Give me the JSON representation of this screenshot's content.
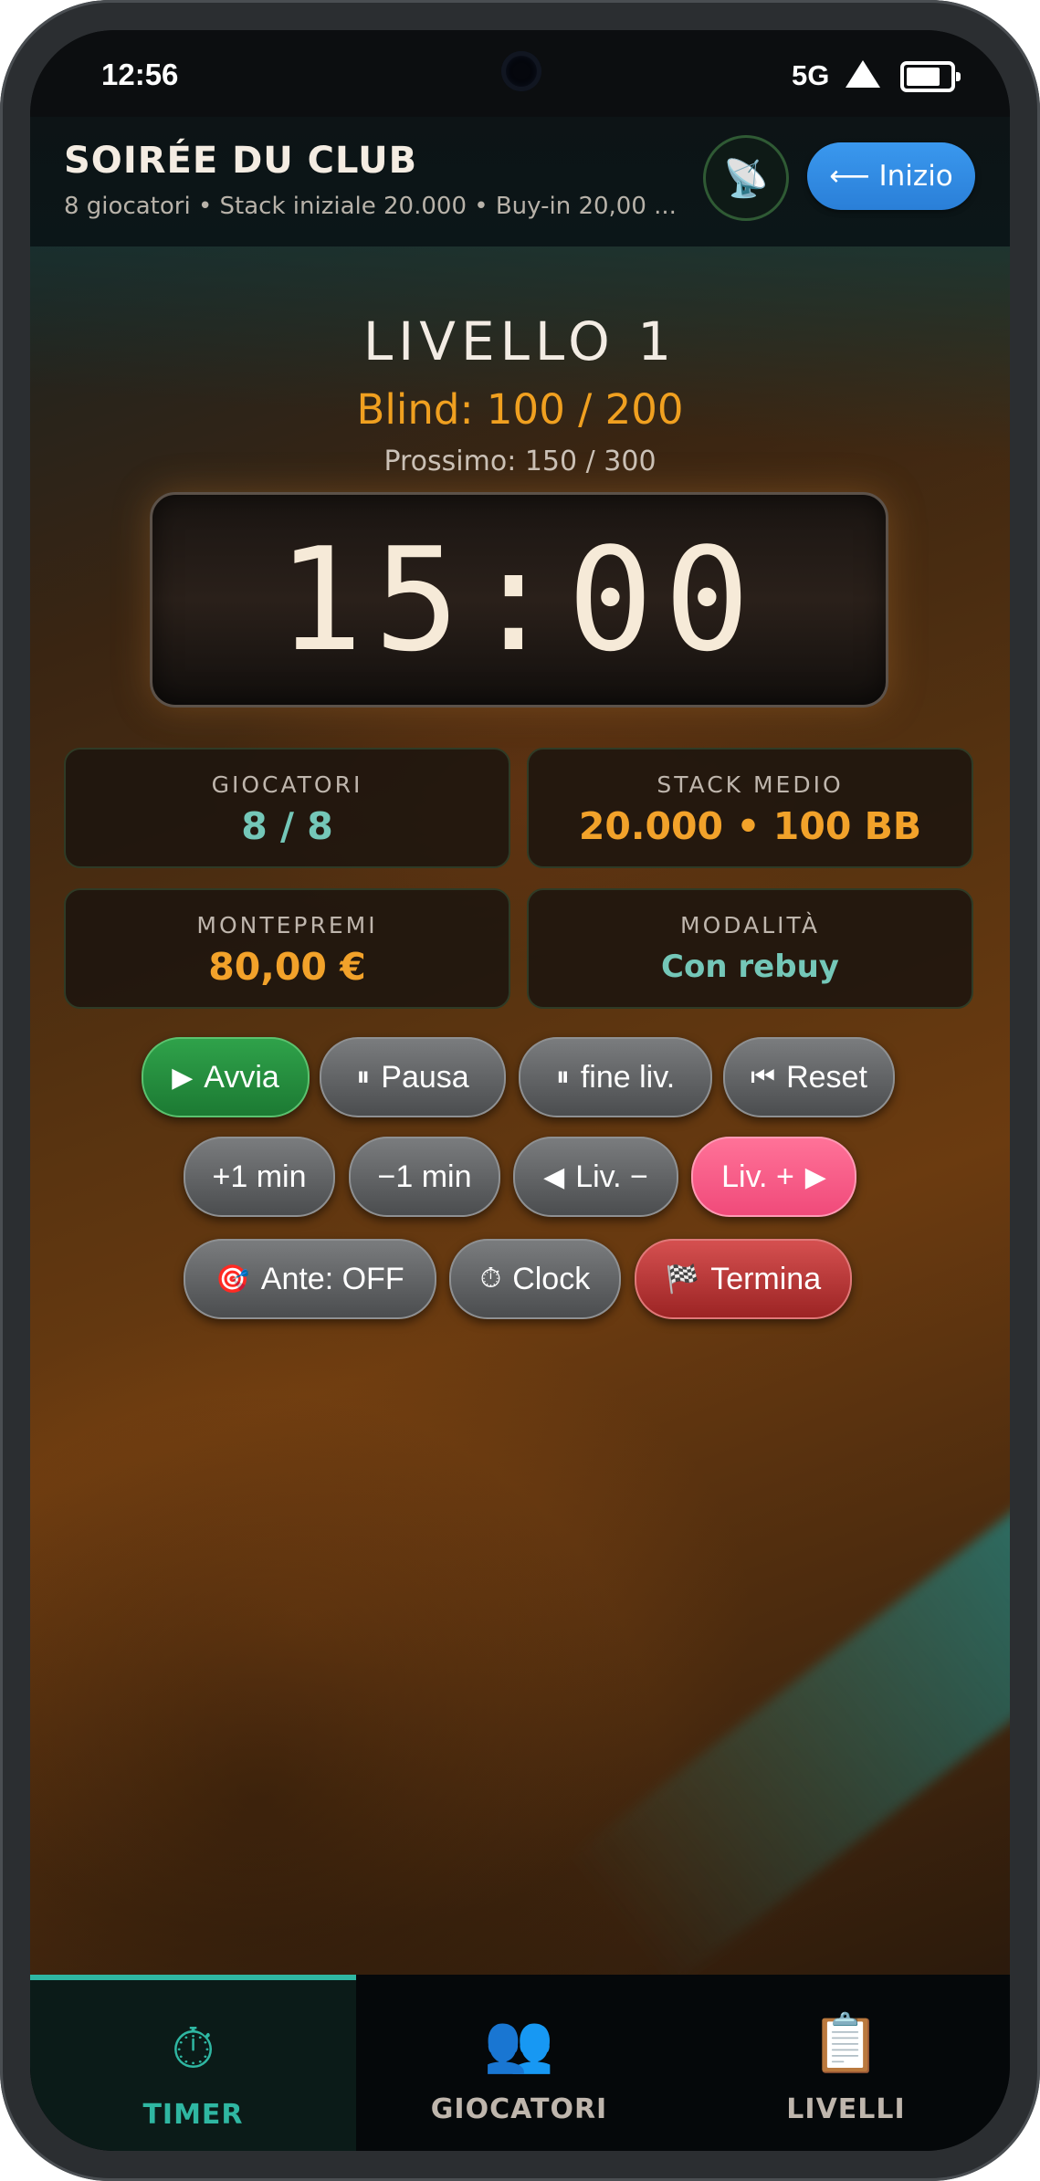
{
  "status_bar": {
    "time": "12:56",
    "network": "5G"
  },
  "header": {
    "title": "SOIRÉE DU CLUB",
    "subtitle": "8 giocatori • Stack iniziale 20.000 • Buy-in 20,00 ...",
    "cast_icon": "satellite-antenna-icon",
    "home_label": "⟵ Inizio"
  },
  "level": {
    "title": "LIVELLO 1",
    "blind": "Blind: 100 / 200",
    "next": "Prossimo: 150 / 300",
    "clock": "15:00"
  },
  "stats": {
    "players": {
      "label": "GIOCATORI",
      "value": "8 / 8"
    },
    "avg_stack": {
      "label": "STACK MEDIO",
      "value": "20.000 • 100 BB"
    },
    "prize_pool": {
      "label": "MONTEPREMI",
      "value": "80,00 €"
    },
    "mode": {
      "label": "MODALITÀ",
      "value": "Con rebuy"
    }
  },
  "controls": {
    "row1": [
      {
        "icon": "▶",
        "label": "Avvia"
      },
      {
        "icon": "⏸",
        "label": "Pausa"
      },
      {
        "icon": "⏸",
        "label": "fine liv."
      },
      {
        "icon": "⏮",
        "label": "Reset"
      }
    ],
    "row2": [
      {
        "label": "+1 min"
      },
      {
        "label": "−1 min"
      },
      {
        "icon": "◀",
        "label": "Liv. −"
      },
      {
        "icon": "▶",
        "label": "Liv. +"
      }
    ],
    "row3": [
      {
        "icon": "🎯",
        "label": "Ante: OFF"
      },
      {
        "icon": "⏱",
        "label": "Clock"
      },
      {
        "icon": "🏁",
        "label": "Termina"
      }
    ]
  },
  "nav": {
    "tabs": [
      {
        "label": "TIMER",
        "icon": "⏱"
      },
      {
        "label": "GIOCATORI",
        "icon": "👥"
      },
      {
        "label": "LIVELLI",
        "icon": "📋"
      }
    ],
    "active": "TIMER"
  },
  "colors": {
    "accent": "#2fb7a2",
    "blind": "#f0a020",
    "start": "#1c7a33",
    "next_level": "#f04a7a",
    "end": "#9c2424"
  }
}
